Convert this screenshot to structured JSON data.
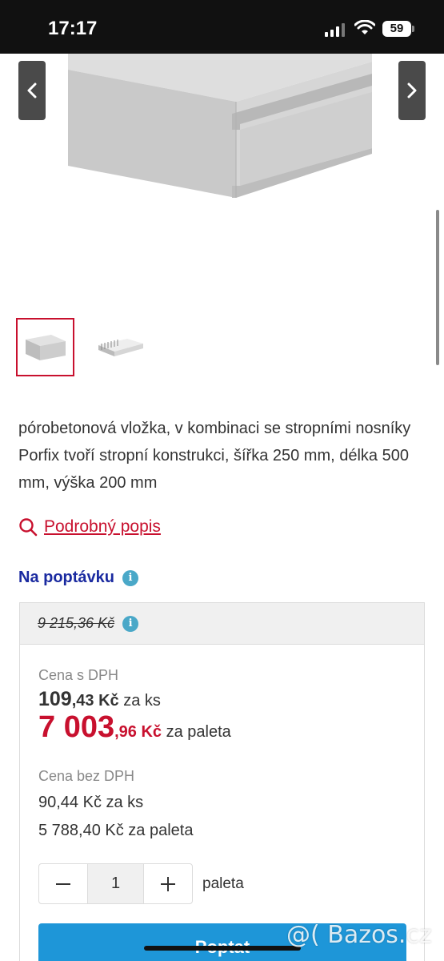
{
  "status_bar": {
    "time": "17:17",
    "battery": "59",
    "icons": [
      "signal-icon",
      "wifi-icon",
      "battery-icon"
    ]
  },
  "gallery": {
    "prev_icon": "chevron-left-icon",
    "next_icon": "chevron-right-icon",
    "thumbnails": [
      "porobeton-block-thumbnail",
      "ceiling-structure-thumbnail"
    ],
    "selected_thumbnail": 1
  },
  "product": {
    "description": "pórobetonová vložka, v kombinaci se stropními nosníky Porfix tvoří stropní konstrukci, šířka 250 mm, délka 500 mm, výška 200 mm",
    "detail_link": "Podrobný popis",
    "availability": "Na poptávku"
  },
  "pricing": {
    "old_price": "9 215,36 Kč",
    "vat_label": "Cena s DPH",
    "vat_ks_big": "109",
    "vat_ks_small": ",43 Kč",
    "vat_ks_unit": "za ks",
    "vat_pal_big": "7 003",
    "vat_pal_small": ",96 Kč",
    "vat_pal_unit": "za paleta",
    "novat_label": "Cena bez DPH",
    "novat_ks": "90,44 Kč za ks",
    "novat_pal": "5 788,40 Kč za paleta"
  },
  "order": {
    "quantity": "1",
    "unit": "paleta",
    "button": "Poptat"
  },
  "watermark": "@( Bazos.cz",
  "colors": {
    "accent_red": "#c8102e",
    "availability_blue": "#1a2aa0",
    "cta_blue": "#1e96d8",
    "info_teal": "#4aa8c8"
  }
}
